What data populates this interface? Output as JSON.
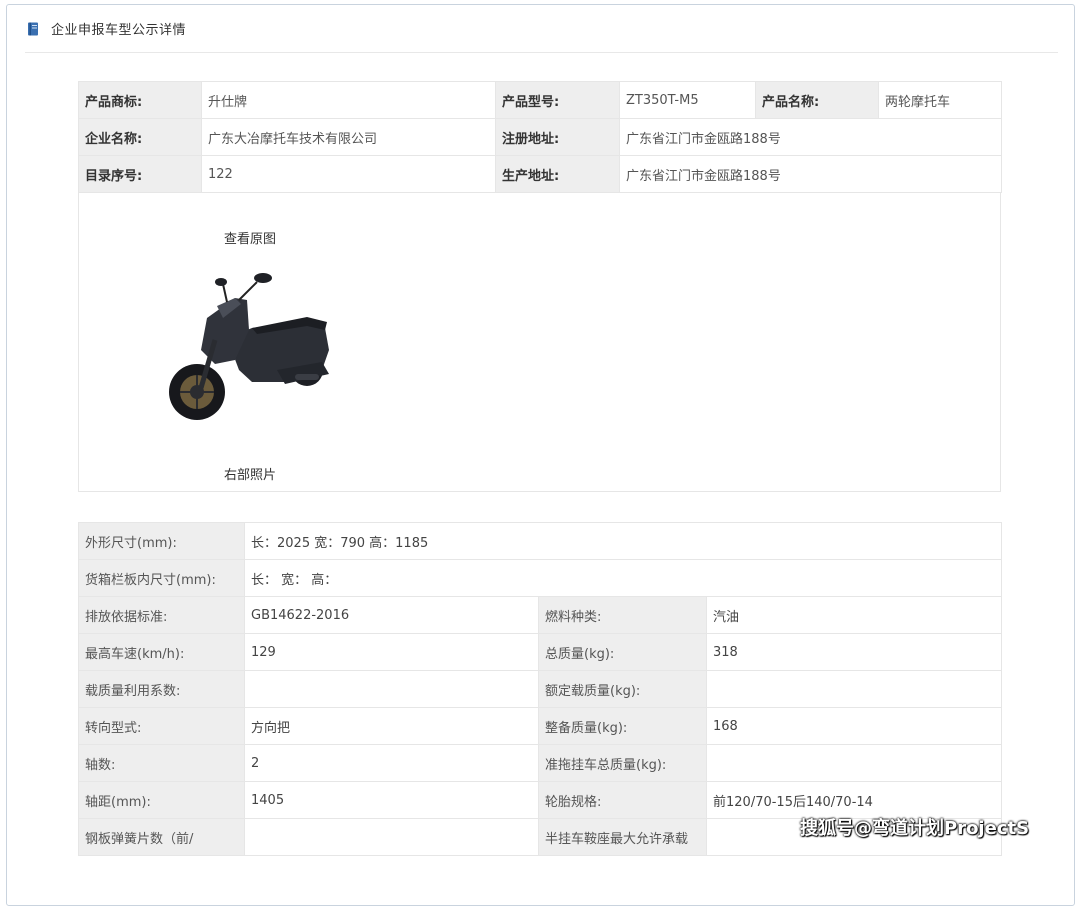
{
  "header": {
    "title": "企业申报车型公示详情",
    "icon": "book-icon"
  },
  "basic": [
    [
      {
        "label": "产品商标:",
        "value": "升仕牌"
      },
      {
        "label": "产品型号:",
        "value": "ZT350T-M5"
      },
      {
        "label": "产品名称:",
        "value": "两轮摩托车"
      }
    ],
    [
      {
        "label": "企业名称:",
        "value": "广东大冶摩托车技术有限公司"
      },
      {
        "label": "注册地址:",
        "value": "广东省江门市金瓯路188号"
      }
    ],
    [
      {
        "label": "目录序号:",
        "value": "122"
      },
      {
        "label": "生产地址:",
        "value": "广东省江门市金瓯路188号"
      }
    ]
  ],
  "photo": {
    "link_top": "查看原图",
    "link_bottom": "右部照片"
  },
  "specs": {
    "full_rows": [
      {
        "label": "外形尺寸(mm):",
        "value": "长：2025 宽：790 高：1185"
      },
      {
        "label": "货箱栏板内尺寸(mm):",
        "value": "长： 宽： 高："
      }
    ],
    "split_rows": [
      {
        "l1": "排放依据标准:",
        "v1": "GB14622-2016",
        "l2": "燃料种类:",
        "v2": "汽油"
      },
      {
        "l1": "最高车速(km/h):",
        "v1": "129",
        "l2": "总质量(kg):",
        "v2": "318"
      },
      {
        "l1": "载质量利用系数:",
        "v1": "",
        "l2": "额定载质量(kg):",
        "v2": ""
      },
      {
        "l1": "转向型式:",
        "v1": "方向把",
        "l2": "整备质量(kg):",
        "v2": "168"
      },
      {
        "l1": "轴数:",
        "v1": "2",
        "l2": "准拖挂车总质量(kg):",
        "v2": ""
      },
      {
        "l1": "轴距(mm):",
        "v1": "1405",
        "l2": "轮胎规格:",
        "v2": "前120/70-15后140/70-14"
      },
      {
        "l1": "钢板弹簧片数（前/",
        "v1": "",
        "l2": "半挂车鞍座最大允许承载",
        "v2": ""
      }
    ]
  },
  "watermark": "搜狐号@弯道计划ProjectS"
}
